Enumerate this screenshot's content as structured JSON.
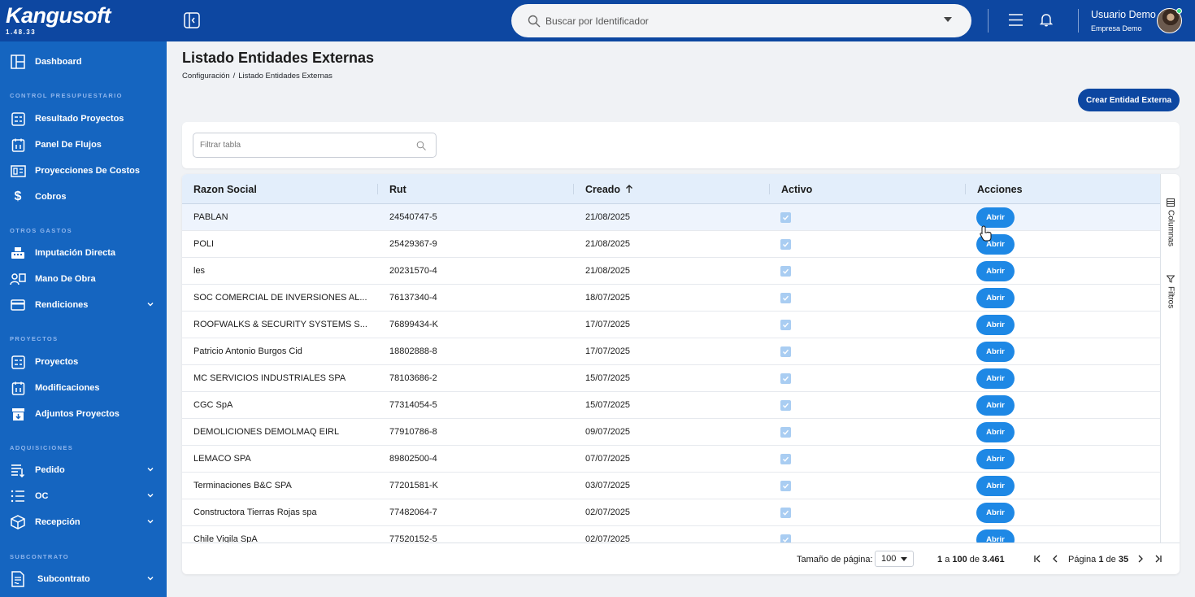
{
  "brand": {
    "name": "Kangusoft",
    "version": "1.48.33"
  },
  "colors": {
    "sidebar": "#1565c0",
    "topbar": "#0d47a1",
    "accent": "#1e88e5",
    "primary_button": "#0d47a1",
    "header_row": "#e3eefb"
  },
  "sidebar": {
    "dashboard": {
      "label": "Dashboard",
      "icon": "dashboard-icon"
    },
    "sections": [
      {
        "title": "CONTROL PRESUPUESTARIO",
        "items": [
          {
            "label": "Resultado Proyectos",
            "icon": "report-icon"
          },
          {
            "label": "Panel De Flujos",
            "icon": "flow-panel-icon"
          },
          {
            "label": "Proyecciones De Costos",
            "icon": "projection-icon"
          },
          {
            "label": "Cobros",
            "icon": "dollar-icon"
          }
        ]
      },
      {
        "title": "OTROS GASTOS",
        "items": [
          {
            "label": "Imputación Directa",
            "icon": "cash-register-icon"
          },
          {
            "label": "Mano De Obra",
            "icon": "workers-icon"
          },
          {
            "label": "Rendiciones",
            "icon": "card-icon",
            "expandable": true
          }
        ]
      },
      {
        "title": "PROYECTOS",
        "items": [
          {
            "label": "Proyectos",
            "icon": "project-icon"
          },
          {
            "label": "Modificaciones",
            "icon": "modification-icon"
          },
          {
            "label": "Adjuntos Proyectos",
            "icon": "attachment-box-icon"
          }
        ]
      },
      {
        "title": "ADQUISICIONES",
        "items": [
          {
            "label": "Pedido",
            "icon": "order-list-icon",
            "expandable": true
          },
          {
            "label": "OC",
            "icon": "checklist-icon",
            "expandable": true
          },
          {
            "label": "Recepción",
            "icon": "package-icon",
            "expandable": true
          }
        ]
      },
      {
        "title": "SUBCONTRATO",
        "items": [
          {
            "label": "Subcontrato",
            "icon": "contract-icon",
            "expandable": true
          }
        ]
      }
    ]
  },
  "topbar": {
    "search_placeholder": "Buscar por Identificador",
    "user_name": "Usuario Demo",
    "user_company": "Empresa Demo"
  },
  "page": {
    "title": "Listado Entidades Externas",
    "breadcrumb": [
      "Configuración",
      "Listado Entidades Externas"
    ],
    "breadcrumb_separator": "/",
    "create_button": "Crear Entidad Externa",
    "filter_placeholder": "Filtrar tabla"
  },
  "table": {
    "columns": [
      "Razon Social",
      "Rut",
      "Creado",
      "Activo",
      "Acciones"
    ],
    "sorted_column": "Creado",
    "sort_direction": "asc",
    "action_label": "Abrir",
    "rows": [
      {
        "razon_social": "PABLAN",
        "rut": "24540747-5",
        "creado": "21/08/2025",
        "activo": true
      },
      {
        "razon_social": "POLI",
        "rut": "25429367-9",
        "creado": "21/08/2025",
        "activo": true
      },
      {
        "razon_social": "les",
        "rut": "20231570-4",
        "creado": "21/08/2025",
        "activo": true
      },
      {
        "razon_social": "SOC COMERCIAL DE INVERSIONES AL...",
        "rut": "76137340-4",
        "creado": "18/07/2025",
        "activo": true
      },
      {
        "razon_social": "ROOFWALKS & SECURITY SYSTEMS S...",
        "rut": "76899434-K",
        "creado": "17/07/2025",
        "activo": true
      },
      {
        "razon_social": "Patricio Antonio Burgos Cid",
        "rut": "18802888-8",
        "creado": "17/07/2025",
        "activo": true
      },
      {
        "razon_social": "MC SERVICIOS INDUSTRIALES SPA",
        "rut": "78103686-2",
        "creado": "15/07/2025",
        "activo": true
      },
      {
        "razon_social": "CGC SpA",
        "rut": "77314054-5",
        "creado": "15/07/2025",
        "activo": true
      },
      {
        "razon_social": "DEMOLICIONES DEMOLMAQ EIRL",
        "rut": "77910786-8",
        "creado": "09/07/2025",
        "activo": true
      },
      {
        "razon_social": "LEMACO SPA",
        "rut": "89802500-4",
        "creado": "07/07/2025",
        "activo": true
      },
      {
        "razon_social": "Terminaciones B&C SPA",
        "rut": "77201581-K",
        "creado": "03/07/2025",
        "activo": true
      },
      {
        "razon_social": "Constructora Tierras Rojas spa",
        "rut": "77482064-7",
        "creado": "02/07/2025",
        "activo": true
      },
      {
        "razon_social": "Chile Vigila SpA",
        "rut": "77520152-5",
        "creado": "02/07/2025",
        "activo": true
      }
    ],
    "side_tabs": [
      "Columnas",
      "Filtros"
    ]
  },
  "pagination": {
    "page_size_label": "Tamaño de página:",
    "page_size": "100",
    "range_from": "1",
    "range_word": "a",
    "range_to": "100",
    "of_word": "de",
    "total": "3.461",
    "page_word": "Página",
    "current_page": "1",
    "total_pages": "35"
  }
}
